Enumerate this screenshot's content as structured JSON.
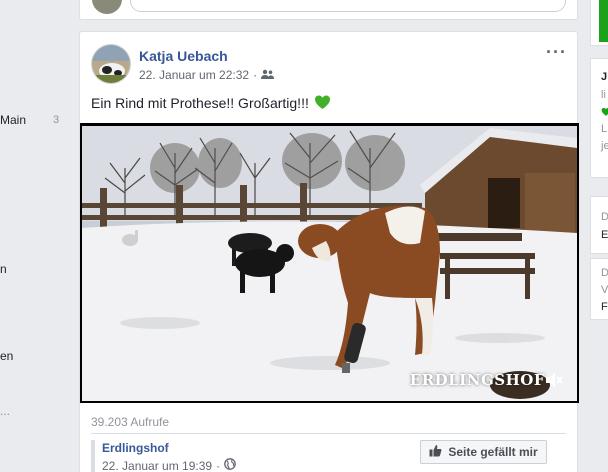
{
  "sidebar": {
    "items": [
      {
        "label": "Main",
        "count": "3"
      },
      {
        "label": "n"
      },
      {
        "label": "en"
      },
      {
        "label": "..."
      }
    ]
  },
  "post": {
    "author": "Katja Uebach",
    "timestamp": "22. Januar um 22:32",
    "audience_icon": "friends-icon",
    "message": "Ein Rind mit Prothese!! Großartig!!!",
    "emoji": "green-heart",
    "video_watermark": "ERDLINGSHOF",
    "views": "39.203 Aufrufe",
    "shared_page": {
      "name": "Erdlingshof",
      "timestamp": "22. Januar um 19:39",
      "like_button_label": "Seite gefällt mir"
    }
  },
  "right_column": {
    "fragments": [
      "J",
      "li",
      "L",
      "je",
      "D",
      "E",
      "D",
      "V",
      "F"
    ]
  },
  "colors": {
    "link": "#385898",
    "background": "#e9ebee",
    "heart": "#43b02a",
    "green_accent": "#1aa31a"
  }
}
